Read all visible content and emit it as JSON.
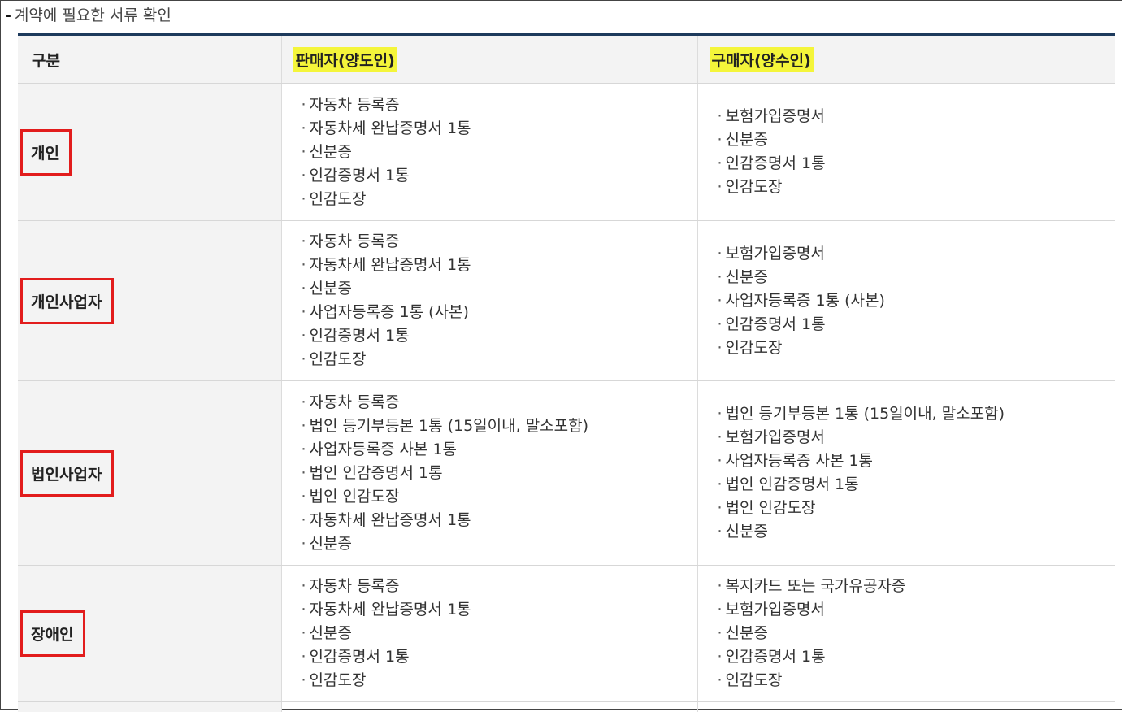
{
  "caption": {
    "dash": "-",
    "text": "계약에 필요한 서류 확인"
  },
  "table": {
    "headers": {
      "category": "구분",
      "seller": "판매자(양도인)",
      "buyer": "구매자(양수인)"
    },
    "rows": [
      {
        "category": "개인",
        "seller": [
          "자동차 등록증",
          "자동차세 완납증명서 1통",
          "신분증",
          "인감증명서 1통",
          "인감도장"
        ],
        "buyer": [
          "보험가입증명서",
          "신분증",
          "인감증명서 1통",
          "인감도장"
        ]
      },
      {
        "category": "개인사업자",
        "seller": [
          "자동차 등록증",
          "자동차세 완납증명서 1통",
          "신분증",
          "사업자등록증 1통 (사본)",
          "인감증명서 1통",
          "인감도장"
        ],
        "buyer": [
          "보험가입증명서",
          "신분증",
          "사업자등록증 1통 (사본)",
          "인감증명서 1통",
          "인감도장"
        ]
      },
      {
        "category": "법인사업자",
        "seller": [
          "자동차 등록증",
          "법인 등기부등본 1통 (15일이내, 말소포함)",
          "사업자등록증 사본 1통",
          "법인 인감증명서 1통",
          "법인 인감도장",
          "자동차세 완납증명서 1통",
          "신분증"
        ],
        "buyer": [
          "법인 등기부등본 1통 (15일이내, 말소포함)",
          "보험가입증명서",
          "사업자등록증 사본 1통",
          "법인 인감증명서 1통",
          "법인 인감도장",
          "신분증"
        ]
      },
      {
        "category": "장애인",
        "seller": [
          "자동차 등록증",
          "자동차세 완납증명서 1통",
          "신분증",
          "인감증명서 1통",
          "인감도장"
        ],
        "buyer": [
          "복지카드 또는 국가유공자증",
          "보험가입증명서",
          "신분증",
          "인감증명서 1통",
          "인감도장"
        ]
      }
    ]
  },
  "colors": {
    "header_border": "#1d3a5c",
    "highlight": "#f4f53a",
    "category_box": "#e21c1c",
    "shaded_bg": "#f3f3f3"
  }
}
